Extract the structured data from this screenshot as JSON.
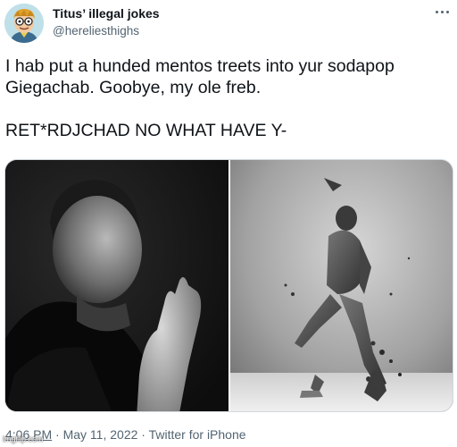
{
  "author": {
    "display_name": "Titus’ illegal jokes",
    "handle": "@hereliesthighs"
  },
  "tweet": {
    "lines": [
      "I hab put a hunded mentos treets into yur sodapop",
      "Giegachab. Goobye, my ole freb.",
      "RET*RDJCHAD NO WHAT HAVE Y-"
    ]
  },
  "media": {
    "left_image": "man-praying-photo",
    "right_image": "figure-shattering-photo"
  },
  "meta": {
    "time": "4:06 PM",
    "separator": " · ",
    "date": "May 11, 2022",
    "source": "Twitter for iPhone"
  },
  "watermark": "imgflip.com",
  "icons": {
    "more": "more-horizontal-icon",
    "avatar": "cartoon-avatar"
  },
  "colors": {
    "text": "#0f1419",
    "secondary": "#536471",
    "border": "#cfd9de"
  }
}
